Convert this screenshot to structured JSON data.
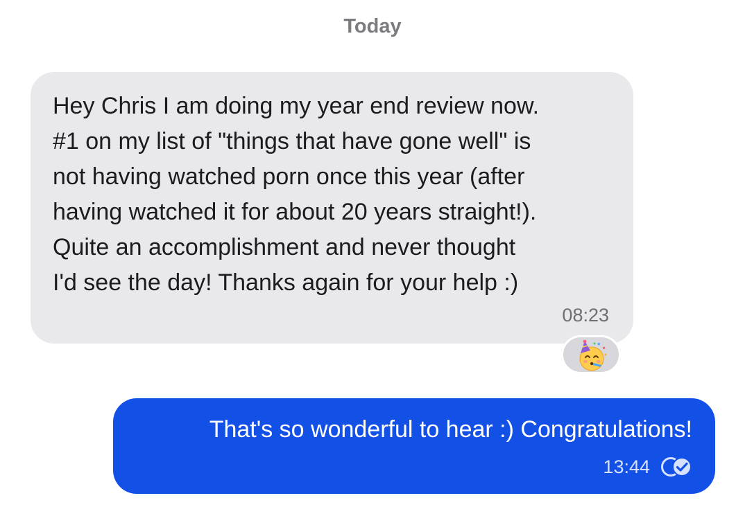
{
  "chat": {
    "date_divider": "Today",
    "messages": [
      {
        "direction": "incoming",
        "text": "Hey Chris I am doing my year end review now.\n#1 on my list of \"things that have gone well\" is\nnot having watched porn once this year (after\nhaving watched it for about 20 years straight!).\nQuite an accomplishment and never thought\nI'd see the day! Thanks again for your help :)",
        "time": "08:23",
        "reaction": "partying-face-emoji"
      },
      {
        "direction": "outgoing",
        "text": "That's so wonderful to hear :) Congratulations!",
        "time": "13:44",
        "status_icon": "read-receipt-icon"
      }
    ]
  },
  "colors": {
    "incoming_bubble": "#e9e9eb",
    "outgoing_bubble": "#1350e6",
    "date_text": "#7b7b80"
  }
}
